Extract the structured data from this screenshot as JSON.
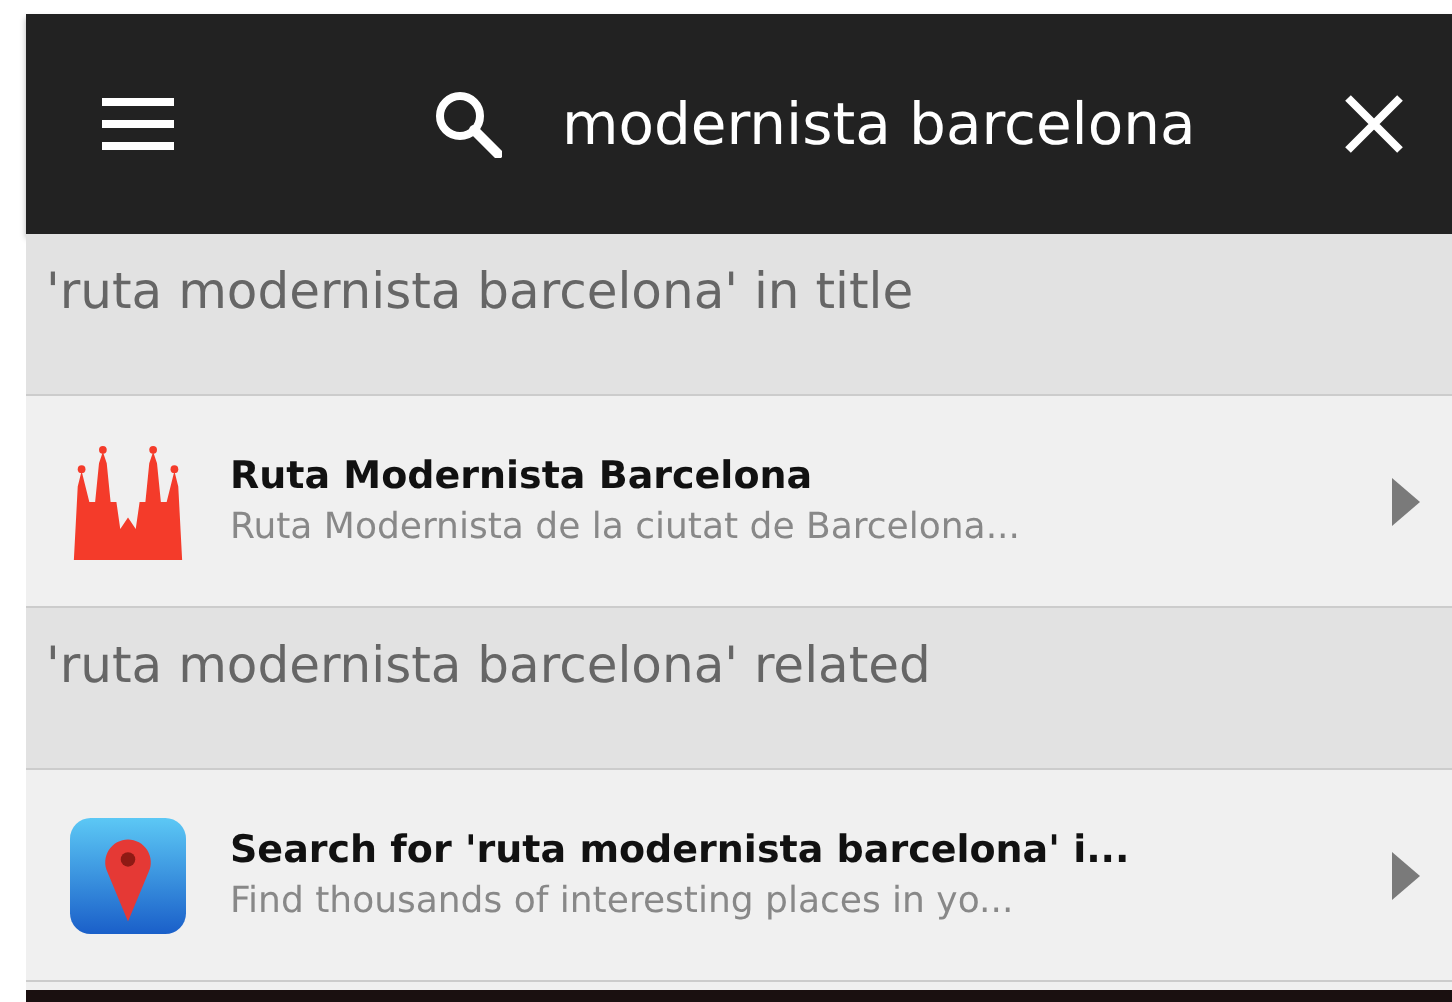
{
  "search_bar": {
    "value": "modernista barcelona"
  },
  "sections": [
    {
      "header": "'ruta modernista barcelona' in title",
      "items": [
        {
          "kind": "cathedral",
          "title": "Ruta Modernista Barcelona",
          "subtitle": "Ruta Modernista de la ciutat de Barcelona..."
        }
      ]
    },
    {
      "header": "'ruta modernista barcelona' related",
      "items": [
        {
          "kind": "map",
          "title": "Search for 'ruta modernista barcelona' i...",
          "subtitle": "Find thousands of interesting places in yo..."
        }
      ]
    }
  ]
}
